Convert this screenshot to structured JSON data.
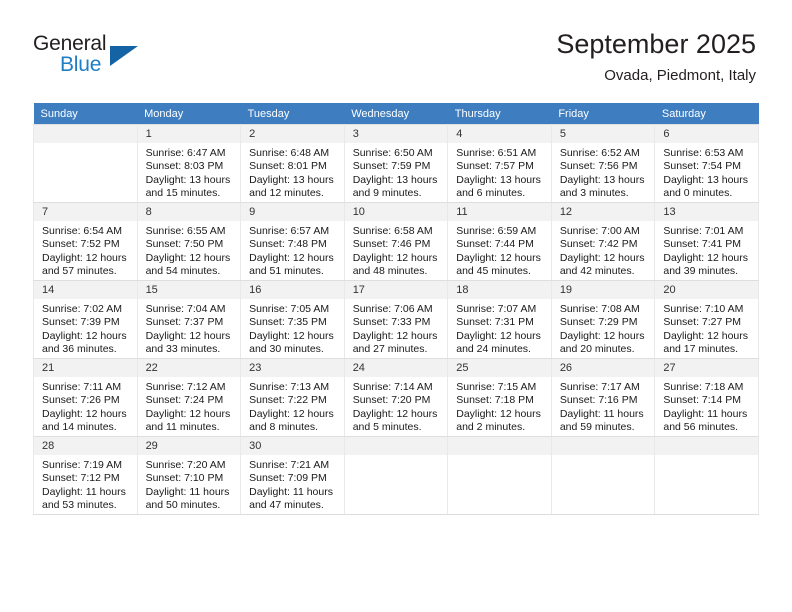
{
  "brand": {
    "name_part1": "General",
    "name_part2": "Blue",
    "accent_color": "#1f7fc4",
    "triangle_color": "#1464a5"
  },
  "header": {
    "month_title": "September 2025",
    "location": "Ovada, Piedmont, Italy"
  },
  "calendar": {
    "header_bg": "#3d7dc0",
    "daynum_bg": "#f2f2f2",
    "weekdays": [
      "Sunday",
      "Monday",
      "Tuesday",
      "Wednesday",
      "Thursday",
      "Friday",
      "Saturday"
    ],
    "weeks": [
      [
        {
          "day": "",
          "empty": true
        },
        {
          "day": "1",
          "sunrise": "Sunrise: 6:47 AM",
          "sunset": "Sunset: 8:03 PM",
          "daylight_line1": "Daylight: 13 hours",
          "daylight_line2": "and 15 minutes."
        },
        {
          "day": "2",
          "sunrise": "Sunrise: 6:48 AM",
          "sunset": "Sunset: 8:01 PM",
          "daylight_line1": "Daylight: 13 hours",
          "daylight_line2": "and 12 minutes."
        },
        {
          "day": "3",
          "sunrise": "Sunrise: 6:50 AM",
          "sunset": "Sunset: 7:59 PM",
          "daylight_line1": "Daylight: 13 hours",
          "daylight_line2": "and 9 minutes."
        },
        {
          "day": "4",
          "sunrise": "Sunrise: 6:51 AM",
          "sunset": "Sunset: 7:57 PM",
          "daylight_line1": "Daylight: 13 hours",
          "daylight_line2": "and 6 minutes."
        },
        {
          "day": "5",
          "sunrise": "Sunrise: 6:52 AM",
          "sunset": "Sunset: 7:56 PM",
          "daylight_line1": "Daylight: 13 hours",
          "daylight_line2": "and 3 minutes."
        },
        {
          "day": "6",
          "sunrise": "Sunrise: 6:53 AM",
          "sunset": "Sunset: 7:54 PM",
          "daylight_line1": "Daylight: 13 hours",
          "daylight_line2": "and 0 minutes."
        }
      ],
      [
        {
          "day": "7",
          "sunrise": "Sunrise: 6:54 AM",
          "sunset": "Sunset: 7:52 PM",
          "daylight_line1": "Daylight: 12 hours",
          "daylight_line2": "and 57 minutes."
        },
        {
          "day": "8",
          "sunrise": "Sunrise: 6:55 AM",
          "sunset": "Sunset: 7:50 PM",
          "daylight_line1": "Daylight: 12 hours",
          "daylight_line2": "and 54 minutes."
        },
        {
          "day": "9",
          "sunrise": "Sunrise: 6:57 AM",
          "sunset": "Sunset: 7:48 PM",
          "daylight_line1": "Daylight: 12 hours",
          "daylight_line2": "and 51 minutes."
        },
        {
          "day": "10",
          "sunrise": "Sunrise: 6:58 AM",
          "sunset": "Sunset: 7:46 PM",
          "daylight_line1": "Daylight: 12 hours",
          "daylight_line2": "and 48 minutes."
        },
        {
          "day": "11",
          "sunrise": "Sunrise: 6:59 AM",
          "sunset": "Sunset: 7:44 PM",
          "daylight_line1": "Daylight: 12 hours",
          "daylight_line2": "and 45 minutes."
        },
        {
          "day": "12",
          "sunrise": "Sunrise: 7:00 AM",
          "sunset": "Sunset: 7:42 PM",
          "daylight_line1": "Daylight: 12 hours",
          "daylight_line2": "and 42 minutes."
        },
        {
          "day": "13",
          "sunrise": "Sunrise: 7:01 AM",
          "sunset": "Sunset: 7:41 PM",
          "daylight_line1": "Daylight: 12 hours",
          "daylight_line2": "and 39 minutes."
        }
      ],
      [
        {
          "day": "14",
          "sunrise": "Sunrise: 7:02 AM",
          "sunset": "Sunset: 7:39 PM",
          "daylight_line1": "Daylight: 12 hours",
          "daylight_line2": "and 36 minutes."
        },
        {
          "day": "15",
          "sunrise": "Sunrise: 7:04 AM",
          "sunset": "Sunset: 7:37 PM",
          "daylight_line1": "Daylight: 12 hours",
          "daylight_line2": "and 33 minutes."
        },
        {
          "day": "16",
          "sunrise": "Sunrise: 7:05 AM",
          "sunset": "Sunset: 7:35 PM",
          "daylight_line1": "Daylight: 12 hours",
          "daylight_line2": "and 30 minutes."
        },
        {
          "day": "17",
          "sunrise": "Sunrise: 7:06 AM",
          "sunset": "Sunset: 7:33 PM",
          "daylight_line1": "Daylight: 12 hours",
          "daylight_line2": "and 27 minutes."
        },
        {
          "day": "18",
          "sunrise": "Sunrise: 7:07 AM",
          "sunset": "Sunset: 7:31 PM",
          "daylight_line1": "Daylight: 12 hours",
          "daylight_line2": "and 24 minutes."
        },
        {
          "day": "19",
          "sunrise": "Sunrise: 7:08 AM",
          "sunset": "Sunset: 7:29 PM",
          "daylight_line1": "Daylight: 12 hours",
          "daylight_line2": "and 20 minutes."
        },
        {
          "day": "20",
          "sunrise": "Sunrise: 7:10 AM",
          "sunset": "Sunset: 7:27 PM",
          "daylight_line1": "Daylight: 12 hours",
          "daylight_line2": "and 17 minutes."
        }
      ],
      [
        {
          "day": "21",
          "sunrise": "Sunrise: 7:11 AM",
          "sunset": "Sunset: 7:26 PM",
          "daylight_line1": "Daylight: 12 hours",
          "daylight_line2": "and 14 minutes."
        },
        {
          "day": "22",
          "sunrise": "Sunrise: 7:12 AM",
          "sunset": "Sunset: 7:24 PM",
          "daylight_line1": "Daylight: 12 hours",
          "daylight_line2": "and 11 minutes."
        },
        {
          "day": "23",
          "sunrise": "Sunrise: 7:13 AM",
          "sunset": "Sunset: 7:22 PM",
          "daylight_line1": "Daylight: 12 hours",
          "daylight_line2": "and 8 minutes."
        },
        {
          "day": "24",
          "sunrise": "Sunrise: 7:14 AM",
          "sunset": "Sunset: 7:20 PM",
          "daylight_line1": "Daylight: 12 hours",
          "daylight_line2": "and 5 minutes."
        },
        {
          "day": "25",
          "sunrise": "Sunrise: 7:15 AM",
          "sunset": "Sunset: 7:18 PM",
          "daylight_line1": "Daylight: 12 hours",
          "daylight_line2": "and 2 minutes."
        },
        {
          "day": "26",
          "sunrise": "Sunrise: 7:17 AM",
          "sunset": "Sunset: 7:16 PM",
          "daylight_line1": "Daylight: 11 hours",
          "daylight_line2": "and 59 minutes."
        },
        {
          "day": "27",
          "sunrise": "Sunrise: 7:18 AM",
          "sunset": "Sunset: 7:14 PM",
          "daylight_line1": "Daylight: 11 hours",
          "daylight_line2": "and 56 minutes."
        }
      ],
      [
        {
          "day": "28",
          "sunrise": "Sunrise: 7:19 AM",
          "sunset": "Sunset: 7:12 PM",
          "daylight_line1": "Daylight: 11 hours",
          "daylight_line2": "and 53 minutes."
        },
        {
          "day": "29",
          "sunrise": "Sunrise: 7:20 AM",
          "sunset": "Sunset: 7:10 PM",
          "daylight_line1": "Daylight: 11 hours",
          "daylight_line2": "and 50 minutes."
        },
        {
          "day": "30",
          "sunrise": "Sunrise: 7:21 AM",
          "sunset": "Sunset: 7:09 PM",
          "daylight_line1": "Daylight: 11 hours",
          "daylight_line2": "and 47 minutes."
        },
        {
          "day": "",
          "empty": true
        },
        {
          "day": "",
          "empty": true
        },
        {
          "day": "",
          "empty": true
        },
        {
          "day": "",
          "empty": true
        }
      ]
    ]
  }
}
